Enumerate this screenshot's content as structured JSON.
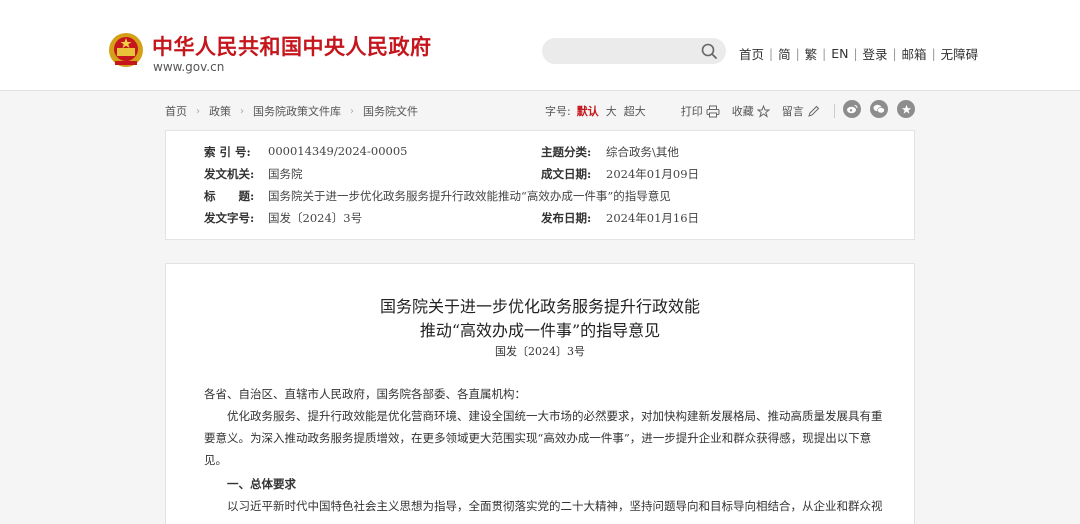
{
  "header": {
    "site_name": "中华人民共和国中央人民政府",
    "site_url": "www.gov.cn",
    "search": {
      "placeholder": ""
    },
    "nav": [
      "首页",
      "简",
      "繁",
      "EN",
      "登录",
      "邮箱",
      "无障碍"
    ]
  },
  "breadcrumb": [
    "首页",
    "政策",
    "国务院政策文件库",
    "国务院文件"
  ],
  "toolbar": {
    "font_size_label": "字号:",
    "sizes": [
      "默认",
      "大",
      "超大"
    ],
    "print": "打印",
    "favorite": "收藏",
    "comment": "留言",
    "share_icons": [
      "weibo-icon",
      "wechat-icon",
      "favorite-star-icon"
    ]
  },
  "meta": {
    "index_label": "索 引 号:",
    "index_value": "000014349/2024-00005",
    "category_label": "主题分类:",
    "category_value": "综合政务\\其他",
    "issuer_label": "发文机关:",
    "issuer_value": "国务院",
    "date_made_label": "成文日期:",
    "date_made_value": "2024年01月09日",
    "title_label": "标　　题:",
    "title_value": "国务院关于进一步优化政务服务提升行政效能推动“高效办成一件事”的指导意见",
    "docno_label": "发文字号:",
    "docno_value": "国发〔2024〕3号",
    "publish_label": "发布日期:",
    "publish_value": "2024年01月16日"
  },
  "article": {
    "title_line1": "国务院关于进一步优化政务服务提升行政效能",
    "title_line2": "推动“高效办成一件事”的指导意见",
    "doc_number": "国发〔2024〕3号",
    "salutation": "各省、自治区、直辖市人民政府，国务院各部委、各直属机构：",
    "para1": "优化政务服务、提升行政效能是优化营商环境、建设全国统一大市场的必然要求，对加快构建新发展格局、推动高质量发展具有重要意义。为深入推动政务服务提质增效，在更多领域更大范围实现“高效办成一件事”，进一步提升企业和群众获得感，现提出以下意见。",
    "section1": "一、总体要求",
    "para2": "以习近平新时代中国特色社会主义思想为指导，全面贯彻落实党的二十大精神，坚持问题导向和目标导向相结合，从企业和群众视"
  },
  "colors": {
    "brand_red": "#c4161c",
    "background": "#f5f5f5"
  }
}
